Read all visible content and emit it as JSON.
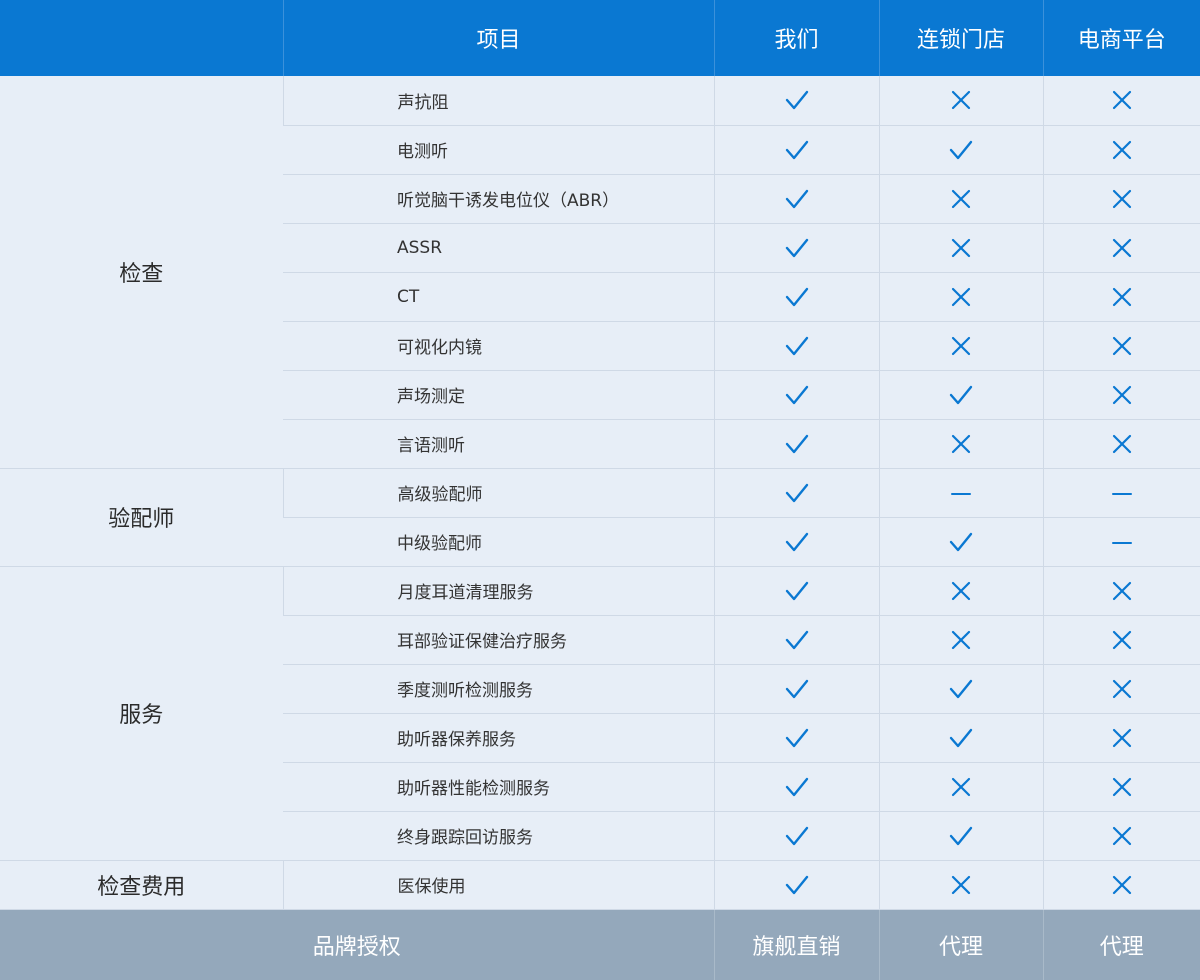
{
  "header": {
    "col_category": "",
    "col_item": "项目",
    "col_us": "我们",
    "col_chain": "连锁门店",
    "col_ecommerce": "电商平台"
  },
  "colors": {
    "header_bg": "#0a78d2",
    "row_bg": "#e7eef7",
    "footer_bg": "#94a8bb",
    "mark": "#0a78d2"
  },
  "groups": [
    {
      "category": "检查",
      "rows": [
        {
          "item": "声抗阻",
          "marks": [
            "check",
            "cross",
            "cross"
          ]
        },
        {
          "item": "电测听",
          "marks": [
            "check",
            "check",
            "cross"
          ]
        },
        {
          "item": "听觉脑干诱发电位仪（ABR）",
          "marks": [
            "check",
            "cross",
            "cross"
          ]
        },
        {
          "item": "ASSR",
          "marks": [
            "check",
            "cross",
            "cross"
          ]
        },
        {
          "item": "CT",
          "marks": [
            "check",
            "cross",
            "cross"
          ]
        },
        {
          "item": "可视化内镜",
          "marks": [
            "check",
            "cross",
            "cross"
          ]
        },
        {
          "item": "声场测定",
          "marks": [
            "check",
            "check",
            "cross"
          ]
        },
        {
          "item": "言语测听",
          "marks": [
            "check",
            "cross",
            "cross"
          ]
        }
      ]
    },
    {
      "category": "验配师",
      "rows": [
        {
          "item": "高级验配师",
          "marks": [
            "check",
            "dash",
            "dash"
          ]
        },
        {
          "item": "中级验配师",
          "marks": [
            "check",
            "check",
            "dash"
          ]
        }
      ]
    },
    {
      "category": "服务",
      "rows": [
        {
          "item": "月度耳道清理服务",
          "marks": [
            "check",
            "cross",
            "cross"
          ]
        },
        {
          "item": "耳部验证保健治疗服务",
          "marks": [
            "check",
            "cross",
            "cross"
          ]
        },
        {
          "item": "季度测听检测服务",
          "marks": [
            "check",
            "check",
            "cross"
          ]
        },
        {
          "item": "助听器保养服务",
          "marks": [
            "check",
            "check",
            "cross"
          ]
        },
        {
          "item": "助听器性能检测服务",
          "marks": [
            "check",
            "cross",
            "cross"
          ]
        },
        {
          "item": "终身跟踪回访服务",
          "marks": [
            "check",
            "check",
            "cross"
          ]
        }
      ]
    },
    {
      "category": "检查费用",
      "rows": [
        {
          "item": "医保使用",
          "marks": [
            "check",
            "cross",
            "cross"
          ]
        }
      ]
    }
  ],
  "footer": {
    "label": "品牌授权",
    "us": "旗舰直销",
    "chain": "代理",
    "ecommerce": "代理"
  }
}
